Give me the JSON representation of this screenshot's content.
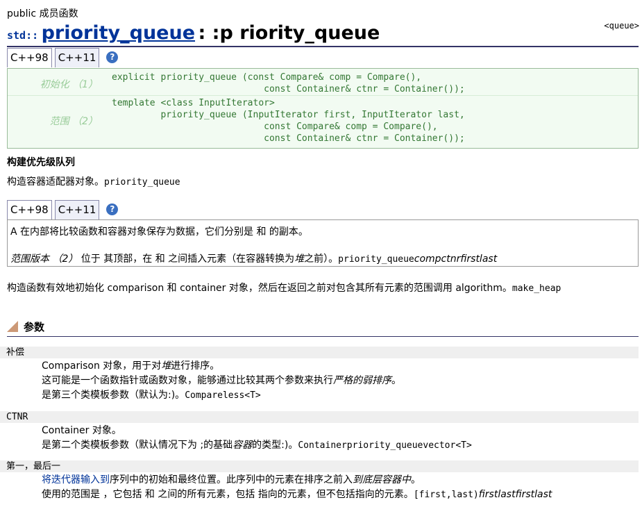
{
  "section_label": "public 成员函数",
  "header_tag": "<queue>",
  "title": {
    "ns": "std::",
    "name": "priority_queue",
    "rest": ": :p riority_queue"
  },
  "tabs1": {
    "tab_a": "C++98",
    "tab_b": "C++11",
    "help": "?"
  },
  "prototypes": [
    {
      "label": "初始化 （1）",
      "code": "explicit priority_queue (const Compare& comp = Compare(),\n                            const Container& ctnr = Container());"
    },
    {
      "label": "范围 （2）",
      "code": "template <class InputIterator>\n         priority_queue (InputIterator first, InputIterator last,\n                            const Compare& comp = Compare(),\n                            const Container& ctnr = Container());"
    }
  ],
  "construct_heading": "构建优先级队列",
  "construct_text": "构造容器适配器对象。",
  "construct_code": "priority_queue",
  "tabs2": {
    "tab_a": "C++98",
    "tab_b": "C++11",
    "help": "?"
  },
  "desc": {
    "line1": "A 在内部将比较函数和容器对象保存为数据，它们分别是 和 的副本。",
    "line2_italic": "范围版本 （2）",
    "line2_text": " 位于 其顶部，在 和 之间插入元素（在容器转换为",
    "line2_heap": "堆",
    "line2_text2": "之前）。",
    "line2_code": "priority_queue",
    "line2_tail": "compctnrfirstlast"
  },
  "init_text": "构造函数有效地初始化 comparison 和 container 对象，然后在返回之前对包含其所有元素的范围调用 algorithm。",
  "init_code": "make_heap",
  "params_heading": "参数",
  "params": {
    "comp": {
      "name": "补偿",
      "l1": "Comparison 对象，用于对",
      "l1_i": "堆",
      "l1_b": "进行排序。",
      "l2": "这可能是一个函数指针或函数对象，能够通过比较其两个参数来执行",
      "l2_i": "严格的弱排序",
      "l2_b": "。",
      "l3": "是第三个类模板参数（默认为:)。",
      "l3_code": "Compareless<T>"
    },
    "ctnr": {
      "name": "CTNR",
      "l1": "Container 对象。",
      "l2": "是第二个类模板参数（默认情况下为 ;的基础",
      "l2_i": "容器",
      "l2_b": "的类型:)。",
      "l2_code": "Containerpriority_queuevector<T>"
    },
    "first_last": {
      "name": "第一，最后一",
      "l1_link": "将迭代器输入到",
      "l1": "序列中的初始和最终位置。此序列中的元素在排序之前入",
      "l1_i": "到底层容器中",
      "l1_b": "。",
      "l2": "使用的范围是 ，它包括 和 之间的所有元素，包括 指向的元素，但不包括指向的元素。",
      "l2_code": "[first,last)",
      "l2_tail": "firstlastfirstlast"
    }
  }
}
